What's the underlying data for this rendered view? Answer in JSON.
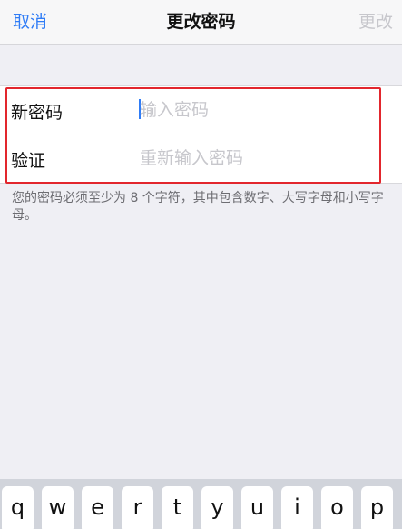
{
  "nav": {
    "cancel_label": "取消",
    "title": "更改密码",
    "change_label": "更改"
  },
  "form": {
    "rows": [
      {
        "label": "新密码",
        "placeholder": "输入密码",
        "value": ""
      },
      {
        "label": "验证",
        "placeholder": "重新输入密码",
        "value": ""
      }
    ]
  },
  "hint": "您的密码必须至少为 8 个字符，其中包含数字、大写字母和小写字母。",
  "keyboard": {
    "row1": [
      "q",
      "w",
      "e",
      "r",
      "t",
      "y",
      "u",
      "i",
      "o",
      "p"
    ]
  },
  "colors": {
    "accent": "#2f7cf6",
    "disabled": "#c7c7cc",
    "highlight": "#e2262d",
    "background": "#efeff4"
  }
}
